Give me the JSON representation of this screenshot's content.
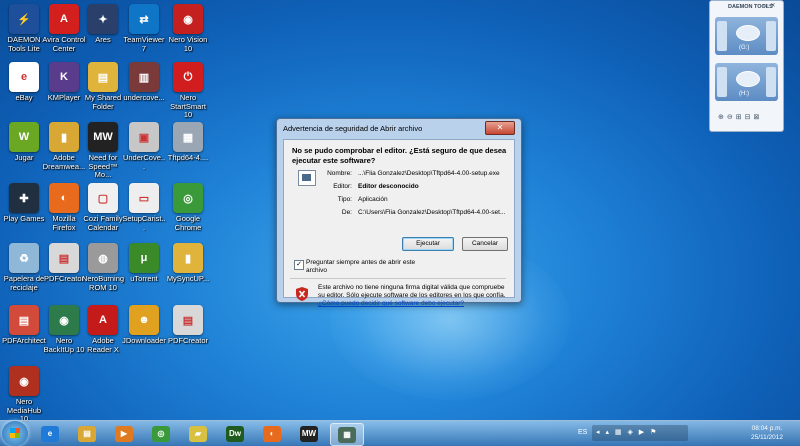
{
  "desktop_icons": [
    {
      "label": "DAEMON Tools Lite",
      "icon": "daemon-icon",
      "color": "#1e4f9a",
      "glyph": "⚡"
    },
    {
      "label": "Avira Control Center",
      "icon": "avira-icon",
      "color": "#d41f1f",
      "glyph": "A"
    },
    {
      "label": "Ares",
      "icon": "ares-icon",
      "color": "#2b3f6b",
      "glyph": "✦"
    },
    {
      "label": "TeamViewer 7",
      "icon": "teamviewer-icon",
      "color": "#0e75c7",
      "glyph": "⇄"
    },
    {
      "label": "Nero Vision 10",
      "icon": "nero-vision-icon",
      "color": "#c42020",
      "glyph": "◉"
    },
    {
      "label": "eBay",
      "icon": "ebay-icon",
      "color": "#ffffff",
      "glyph": "e"
    },
    {
      "label": "KMPlayer",
      "icon": "kmplayer-icon",
      "color": "#5a3c8c",
      "glyph": "K"
    },
    {
      "label": "My Shared Folder",
      "icon": "shared-folder-icon",
      "color": "#e0b33a",
      "glyph": "▤"
    },
    {
      "label": "undercove...",
      "icon": "winrar-icon",
      "color": "#7a3a3a",
      "glyph": "▥"
    },
    {
      "label": "Nero StartSmart 10",
      "icon": "nero-startsmart-icon",
      "color": "#d11d1d",
      "glyph": "⏻"
    },
    {
      "label": "Jugar",
      "icon": "games-icon",
      "color": "#6aa823",
      "glyph": "W"
    },
    {
      "label": "Adobe Dreamwea...",
      "icon": "dreamweaver-folder-icon",
      "color": "#d9a834",
      "glyph": "▮"
    },
    {
      "label": "Need for Speed™ Mo...",
      "icon": "nfs-icon",
      "color": "#222222",
      "glyph": "MW"
    },
    {
      "label": "UnderCove...",
      "icon": "undercover-icon",
      "color": "#c7c7c7",
      "glyph": "▣"
    },
    {
      "label": "Tftpd64-4....",
      "icon": "tftpd-icon",
      "color": "#9aa6b4",
      "glyph": "▦"
    },
    {
      "label": "Play Games",
      "icon": "play-games-icon",
      "color": "#203040",
      "glyph": "✚"
    },
    {
      "label": "Mozilla Firefox",
      "icon": "firefox-icon",
      "color": "#e86a1d",
      "glyph": "◐"
    },
    {
      "label": "Cozi Family Calendar",
      "icon": "cozi-icon",
      "color": "#f0f0f0",
      "glyph": "▢"
    },
    {
      "label": "SetupCarist...",
      "icon": "setup-icon",
      "color": "#eeeeee",
      "glyph": "▭"
    },
    {
      "label": "Google Chrome",
      "icon": "chrome-icon",
      "color": "#3a9a3a",
      "glyph": "◎"
    },
    {
      "label": "Papelera de reciclaje",
      "icon": "recycle-bin-icon",
      "color": "#8fb8d8",
      "glyph": "♻"
    },
    {
      "label": "PDFCreator",
      "icon": "pdfcreator-icon",
      "color": "#d8d8d8",
      "glyph": "▤"
    },
    {
      "label": "NeroBurning ROM 10",
      "icon": "nero-burning-icon",
      "color": "#9a9a9a",
      "glyph": "◍"
    },
    {
      "label": "uTorrent",
      "icon": "utorrent-icon",
      "color": "#3a8a2a",
      "glyph": "μ"
    },
    {
      "label": "MySyncUP...",
      "icon": "mysync-folder-icon",
      "color": "#e0b33a",
      "glyph": "▮"
    },
    {
      "label": "PDFArchitect",
      "icon": "pdfarchitect-icon",
      "color": "#d24a3a",
      "glyph": "▤"
    },
    {
      "label": "Nero BackItUp 10",
      "icon": "nero-backitup-icon",
      "color": "#2d7a4a",
      "glyph": "◉"
    },
    {
      "label": "Adobe Reader X",
      "icon": "adobe-reader-icon",
      "color": "#c51a1a",
      "glyph": "A"
    },
    {
      "label": "JDownloader",
      "icon": "jdownloader-icon",
      "color": "#e0a020",
      "glyph": "☻"
    },
    {
      "label": "PDFCreator",
      "icon": "pdfcreator2-icon",
      "color": "#d8d8d8",
      "glyph": "▤"
    },
    {
      "label": "Nero MediaHub 10",
      "icon": "nero-mediahub-icon",
      "color": "#b03020",
      "glyph": "◉"
    }
  ],
  "dialog": {
    "title": "Advertencia de seguridad de Abrir archivo",
    "close_glyph": "✕",
    "heading": "No se pudo comprobar el editor. ¿Está seguro de que desea ejecutar este software?",
    "fields": [
      {
        "key": "Nombre:",
        "value": "...\\Flia Gonzalez\\Desktop\\Tftpd64-4.00-setup.exe",
        "bold": false
      },
      {
        "key": "Editor:",
        "value": "Editor desconocido",
        "bold": true
      },
      {
        "key": "Tipo:",
        "value": "Aplicación",
        "bold": false
      },
      {
        "key": "De:",
        "value": "C:\\Users\\Flia Gonzalez\\Desktop\\Tftpd64-4.00-set...",
        "bold": false
      }
    ],
    "run_label": "Ejecutar",
    "cancel_label": "Cancelar",
    "checkbox_label": "Preguntar siempre antes de abrir este archivo",
    "checkbox_checked": "✓",
    "warning_text": "Este archivo no tiene ninguna firma digital válida que compruebe su editor. Sólo ejecute software de los editores en los que confía.",
    "help_link": "¿Cómo puedo decidir qué software debo ejecutar?"
  },
  "daemon_widget": {
    "title": "DAEMON TOOLS",
    "controls": "▭ ✕",
    "drives": [
      "(G:)",
      "(H:)"
    ],
    "toolbar": "⊕⊖⊞⊟⊠"
  },
  "taskbar": {
    "apps": [
      {
        "name": "ie",
        "glyph": "e",
        "color": "#1f7ad8"
      },
      {
        "name": "explorer",
        "glyph": "▤",
        "color": "#d9a834"
      },
      {
        "name": "media-player",
        "glyph": "▶",
        "color": "#e07a20"
      },
      {
        "name": "chrome",
        "glyph": "◎",
        "color": "#3a9a3a"
      },
      {
        "name": "sticky",
        "glyph": "▰",
        "color": "#d8c040"
      },
      {
        "name": "dreamweaver",
        "glyph": "Dw",
        "color": "#1f5a1f"
      },
      {
        "name": "firefox",
        "glyph": "◐",
        "color": "#e86a1d"
      },
      {
        "name": "nfs",
        "glyph": "MW",
        "color": "#222222"
      },
      {
        "name": "tftpd",
        "glyph": "▦",
        "color": "#4a6a5a"
      }
    ],
    "language": "ES",
    "tray_icons": "◂ ▴ ▦ ◈ ▶ ⚑",
    "time": "08:04 p.m.",
    "date": "25/11/2012"
  }
}
